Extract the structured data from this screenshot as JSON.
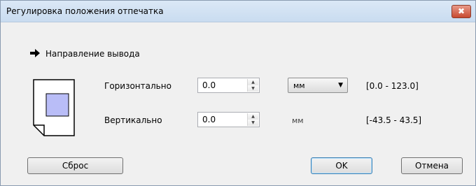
{
  "window": {
    "title": "Регулировка положения отпечатка",
    "close_glyph": "✖"
  },
  "section": {
    "heading": "Направление вывода",
    "arrow_icon": "right-arrow-icon"
  },
  "horizontal": {
    "label": "Горизонтально",
    "value": "0.0",
    "unit_options_selected": "мм",
    "range": "[0.0 - 123.0]"
  },
  "vertical": {
    "label": "Вертикально",
    "value": "0.0",
    "unit": "мм",
    "range": "[-43.5 - 43.5]"
  },
  "buttons": {
    "reset": "Сброс",
    "ok": "OK",
    "cancel": "Отмена"
  },
  "colors": {
    "accent_page_fill": "#b9bdf7",
    "title_bar": "#d5e4f5",
    "close_button": "#c9503a"
  }
}
